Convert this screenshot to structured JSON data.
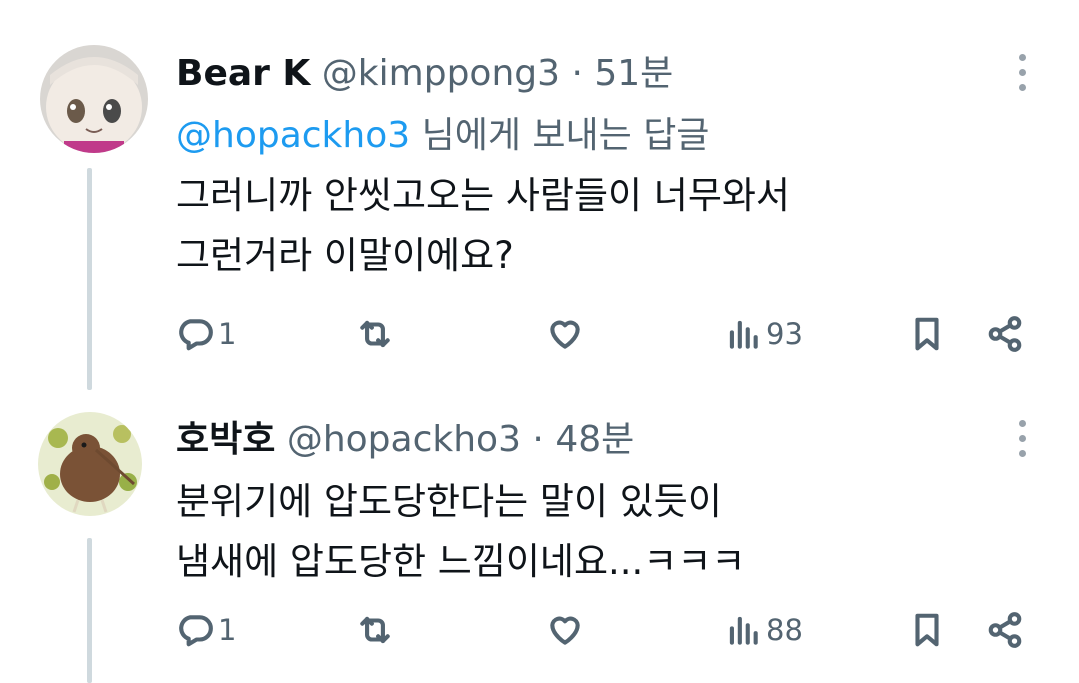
{
  "tweets": [
    {
      "display_name": "Bear K",
      "handle": "@kimppong3",
      "separator": "·",
      "time": "51분",
      "reply_to_mention": "@hopackho3",
      "reply_to_suffix": " 님에게 보내는 답글",
      "text": "그러니까 안씻고오는 사람들이 너무와서\n그런거라 이말이에요?",
      "replies": "1",
      "views": "93",
      "avatar_desc": "cartoon-face-avatar"
    },
    {
      "display_name": "호박호",
      "handle": "@hopackho3",
      "separator": "·",
      "time": "48분",
      "text": "분위기에 압도당한다는 말이 있듯이\n냄새에 압도당한 느낌이네요...ㅋㅋㅋ",
      "replies": "1",
      "views": "88",
      "avatar_desc": "kiwi-bird-avatar"
    }
  ],
  "colors": {
    "link": "#1d9bf0",
    "secondary_text": "#536471",
    "primary_text": "#0f1419",
    "thread_line": "#cfd9de"
  },
  "icons": [
    "reply-icon",
    "retweet-icon",
    "like-icon",
    "views-icon",
    "bookmark-icon",
    "share-icon",
    "more-icon"
  ]
}
